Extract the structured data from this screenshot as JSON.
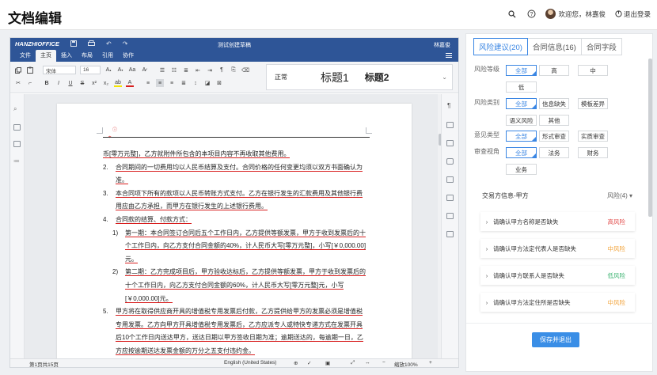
{
  "header": {
    "title": "文档编辑",
    "welcome": "欢迎您，林嘉俊",
    "logout": "退出登录"
  },
  "editor": {
    "brand": "HANZHIOFFICE",
    "doc_name": "测试创建草稿",
    "user": "林嘉俊",
    "menu": [
      "文件",
      "主页",
      "插入",
      "布局",
      "引用",
      "协作"
    ],
    "active_menu": "主页",
    "font_name": "宋体",
    "font_size": "16",
    "styles": [
      "正常",
      "标题1",
      "标题2"
    ],
    "doc": {
      "line0": "币[零万元整]，乙方就附件所包含的本项目内容不再收取其他费用。",
      "items": [
        {
          "num": "2.",
          "text": "合同期间的一切费用均以人民币结算及支付。合同价格的任何变更均须以双方书面确认为准。"
        },
        {
          "num": "3.",
          "text": "本合同项下所有的款项以人民币转账方式支付。乙方在银行发生的汇款费用及其他银行费用应由乙方承担，而甲方在银行发生的上述银行费用。"
        },
        {
          "num": "4.",
          "text": "合同款的结算、付款方式："
        }
      ],
      "sub_items": [
        {
          "num": "1)",
          "text": "第一期：本合同签订合同后五个工作日内，乙方提供等额发票，甲方于收到发票后的十个工作日内，向乙方支付合同金额的40%，计人民币大写[零万元整]，小写[￥0,000.00]元。"
        },
        {
          "num": "2)",
          "text": "第二期：乙方完成项目后，甲方验收达标后，乙方提供等额发票，甲方于收到发票后的十个工作日内，向乙方支付合同金额的60%，计人民币大写[零万元整]元，小写[￥0,000.00]元。"
        }
      ],
      "item5": {
        "num": "5.",
        "text": "甲方将在取得供应商开具的增值税专用发票后付款，乙方提供给甲方的发票必须是增值税专用发票。乙方向甲方开具增值税专用发票后，乙方应派专人或特快专递方式在发票开具后10个工作日内送达甲方，送达日期以甲方签收日期为准；逾期送达的，每逾期一日，乙方应按逾期送达发票金额的万分之五支付违约金。"
      }
    },
    "status": {
      "page": "第1页共15页",
      "language": "English (United States)",
      "zoom": "缩放100%"
    }
  },
  "panel": {
    "tabs": [
      "风险建议(20)",
      "合同信息(16)",
      "合同字段"
    ],
    "filters": {
      "level_label": "风险等级",
      "level_options": [
        "全部",
        "高",
        "中",
        "低"
      ],
      "category_label": "风险类别",
      "category_options": [
        "全部",
        "信息缺失",
        "模板差异",
        "语义风险",
        "其他"
      ],
      "opinion_label": "意见类型",
      "opinion_options": [
        "全部",
        "形式审查",
        "实质审查"
      ],
      "view_label": "审查视角",
      "view_options": [
        "全部",
        "法务",
        "财务",
        "业务"
      ]
    },
    "risk_group": {
      "title": "交易方信息-甲方",
      "count": "风险(4)",
      "items": [
        {
          "text": "请确认甲方名称是否缺失",
          "level": "高风险",
          "color": "#e24c4b"
        },
        {
          "text": "请确认甲方法定代表人是否缺失",
          "level": "中风险",
          "color": "#f2a33a"
        },
        {
          "text": "请确认甲方联系人是否缺失",
          "level": "低风险",
          "color": "#3cb371"
        },
        {
          "text": "请确认甲方法定住所是否缺失",
          "level": "中风险",
          "color": "#f2a33a"
        }
      ]
    },
    "save_button": "保存并退出"
  },
  "colors": {
    "accent": "#3a86e3",
    "editor_bar": "#2e5597",
    "annotation_red": "#d81e1e"
  }
}
